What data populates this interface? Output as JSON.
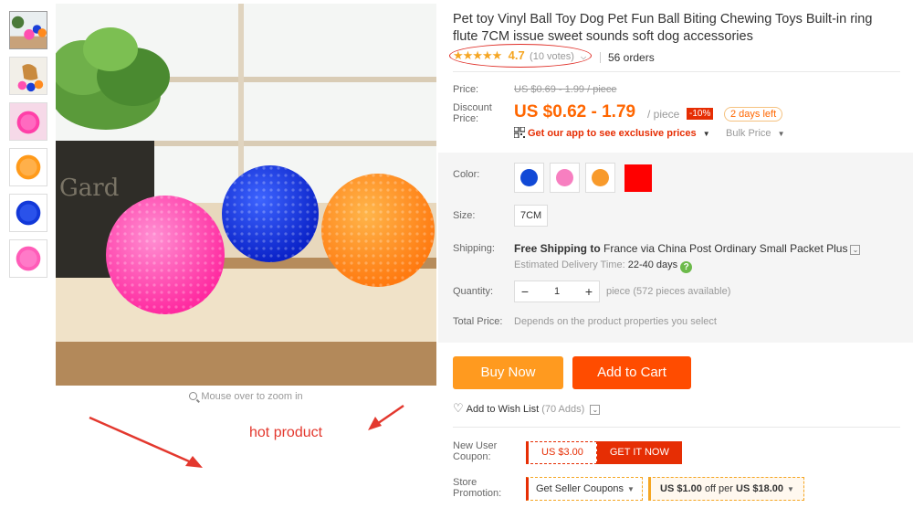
{
  "gallery": {
    "thumbnails": [
      "thumb-balls-plant",
      "thumb-dog-balls",
      "thumb-pink-bath",
      "thumb-orange-ball",
      "thumb-blue-ball",
      "thumb-pink-ball"
    ],
    "zoom_hint": "Mouse over to zoom in"
  },
  "annotation": {
    "text": "hot product",
    "color": "#e3382e"
  },
  "product": {
    "title": "Pet toy Vinyl Ball Toy Dog Pet Fun Ball Biting Chewing Toys Built-in ring flute 7CM issue sweet sounds soft dog accessories",
    "rating": "4.7",
    "votes": "(10 votes)",
    "orders": "56 orders"
  },
  "price": {
    "price_label": "Price:",
    "original": "US $0.69 - 1.99 / piece",
    "discount_label_1": "Discount",
    "discount_label_2": "Price:",
    "discount": "US $0.62 - 1.79",
    "per": "/ piece",
    "percent": "-10%",
    "days_left": "2 days left",
    "app_link": "Get our app to see exclusive prices",
    "bulk": "Bulk Price"
  },
  "options": {
    "color_label": "Color:",
    "colors": [
      "#1149d6",
      "#f77fc0",
      "#f89a2b",
      "#ff0000"
    ],
    "size_label": "Size:",
    "size": "7CM",
    "shipping_label": "Shipping:",
    "shipping_free": "Free Shipping to",
    "shipping_rest": "France via China Post Ordinary Small Packet Plus",
    "delivery_label": "Estimated Delivery Time:",
    "delivery_days": "22-40 days",
    "quantity_label": "Quantity:",
    "quantity": "1",
    "availability": "piece (572 pieces available)",
    "total_label": "Total Price:",
    "total_value": "Depends on the product properties you select"
  },
  "actions": {
    "buy": "Buy Now",
    "cart": "Add to Cart",
    "wish": "Add to Wish List",
    "wish_adds": "(70 Adds)"
  },
  "coupons": {
    "new_user_label_1": "New User",
    "new_user_label_2": "Coupon:",
    "amount": "US $3.00",
    "get": "GET IT NOW",
    "store_label_1": "Store",
    "store_label_2": "Promotion:",
    "seller": "Get Seller Coupons",
    "promo_amount": "US $1.00",
    "promo_mid": "off per",
    "promo_threshold": "US $18.00"
  }
}
